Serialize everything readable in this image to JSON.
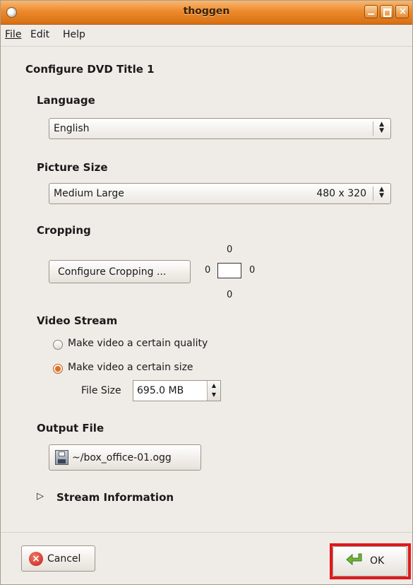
{
  "window": {
    "title": "thoggen"
  },
  "menu": {
    "file": "File",
    "edit": "Edit",
    "help": "Help"
  },
  "dialog": {
    "heading": "Configure DVD Title 1",
    "language": {
      "label": "Language",
      "value": "English"
    },
    "picture_size": {
      "label": "Picture Size",
      "value": "Medium Large",
      "resolution": "480 x 320"
    },
    "cropping": {
      "label": "Cropping",
      "button": "Configure Cropping ...",
      "top": "0",
      "left": "0",
      "right": "0",
      "bottom": "0"
    },
    "video_stream": {
      "label": "Video Stream",
      "option_quality": "Make video a certain quality",
      "option_size": "Make video a certain size",
      "selected": "option_size",
      "file_size_label": "File Size",
      "file_size_value": "695.0 MB"
    },
    "output_file": {
      "label": "Output File",
      "value": "~/box_office-01.ogg"
    },
    "stream_info": {
      "label": "Stream Information",
      "expanded": false
    }
  },
  "buttons": {
    "cancel": "Cancel",
    "ok": "OK"
  },
  "colors": {
    "titlebar": "#ee8a2c",
    "radio_selected": "#e46f1a",
    "highlight": "#e0191c",
    "ok_arrow": "#6fb43a"
  },
  "icons": {
    "cancel": "cancel-icon",
    "ok": "ok-arrow-icon",
    "output": "floppy-icon"
  }
}
